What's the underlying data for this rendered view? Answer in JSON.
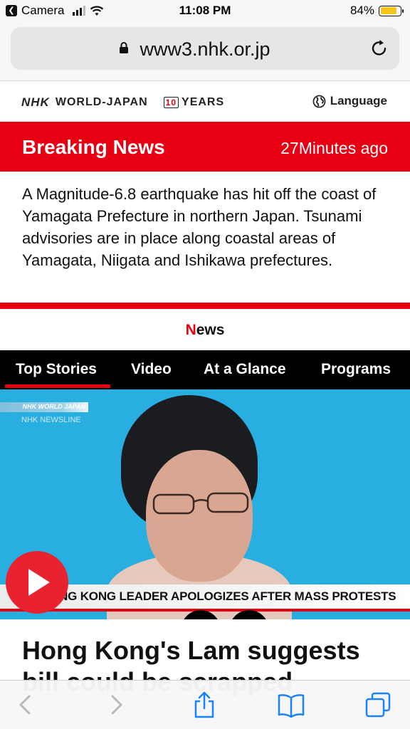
{
  "status_bar": {
    "back_app": "Camera",
    "time": "11:08 PM",
    "battery": "84%",
    "battery_level": 0.84
  },
  "browser": {
    "url": "www3.nhk.or.jp"
  },
  "site": {
    "logo_nhk": "NHK",
    "logo_text": "WORLD-JAPAN",
    "years_mark": "10",
    "years_text": "YEARS",
    "language_label": "Language"
  },
  "breaking": {
    "title": "Breaking News",
    "age": "27Minutes ago",
    "body": "A Magnitude-6.8 earthquake has hit off the coast of Yamagata Prefecture in northern Japan. Tsunami advisories are in place along coastal areas of Yamagata, Niigata and Ishikawa prefectures."
  },
  "news_section": {
    "initial": "N",
    "rest": "ews"
  },
  "tabs": [
    {
      "label": "Top Stories",
      "active": true
    },
    {
      "label": "Video",
      "active": false
    },
    {
      "label": "At a Glance",
      "active": false
    },
    {
      "label": "Programs",
      "active": false
    }
  ],
  "hero": {
    "brand_text": "NHK WORLD JAPAN",
    "sub_brand": "NHK NEWSLINE",
    "lower_third": "HONG KONG LEADER APOLOGIZES AFTER MASS PROTESTS"
  },
  "article": {
    "headline": "Hong Kong's Lam suggests bill could be scrapped"
  },
  "colors": {
    "accent_red": "#e60012",
    "tab_bar": "#000000",
    "hero_bg": "#28aee0",
    "ios_blue": "#1a82fb"
  }
}
